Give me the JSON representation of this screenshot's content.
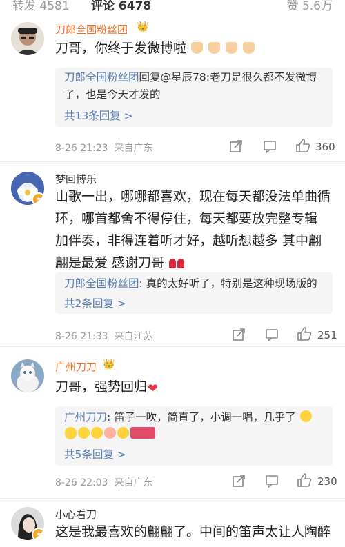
{
  "tabs": {
    "reposts": "转发 4581",
    "comments": "评论 6478",
    "likes": "赞 5.6万"
  },
  "comments": [
    {
      "username": "刀郎全国粉丝团",
      "text": "刀哥，你终于发微博啦",
      "reply_name": "刀郎全国粉丝团",
      "reply_text_1": "回复@星辰78:老刀是很久都不发微博了，也是今天才发的",
      "reply_more": "共13条回复 >",
      "time": "8-26 21:23",
      "location": "来自广东",
      "likes": "360"
    },
    {
      "username": "梦回博乐",
      "text_lines": [
        "山歌一出，哪哪都喜欢，现在每天都没法单曲循",
        "环，哪首都舍不得停住，每天都要放完整专辑",
        "加伴奏，非得连着听才好，越听想越多 其中翩",
        "翩是最爱 感谢刀哥"
      ],
      "reply_name": "刀郎全国粉丝团",
      "reply_text_1": ": 真的太好听了，特别是这种现场版的",
      "reply_more": "共2条回复 >",
      "time": "8-26 21:33",
      "location": "来自江苏",
      "likes": "251"
    },
    {
      "username": "广州刀刀",
      "text": "刀哥，强势回归",
      "reply_name": "广州刀刀",
      "reply_text_1": ": 笛子一吹，简直了，小调一唱，几乎了",
      "reply_more": "共5条回复 >",
      "time": "8-26 22:03",
      "location": "来自广东",
      "likes": "230"
    },
    {
      "username": "小心看刀",
      "text": "这是我最喜欢的翩翩了。中间的笛声太让人陶醉"
    }
  ],
  "colors": {
    "link": "#5b7db1",
    "vip_name": "#f76c1c",
    "reply_bg": "#f5f5f6"
  },
  "icons": {
    "share": "share-icon",
    "comment": "comment-icon",
    "like": "thumbs-up-icon"
  }
}
